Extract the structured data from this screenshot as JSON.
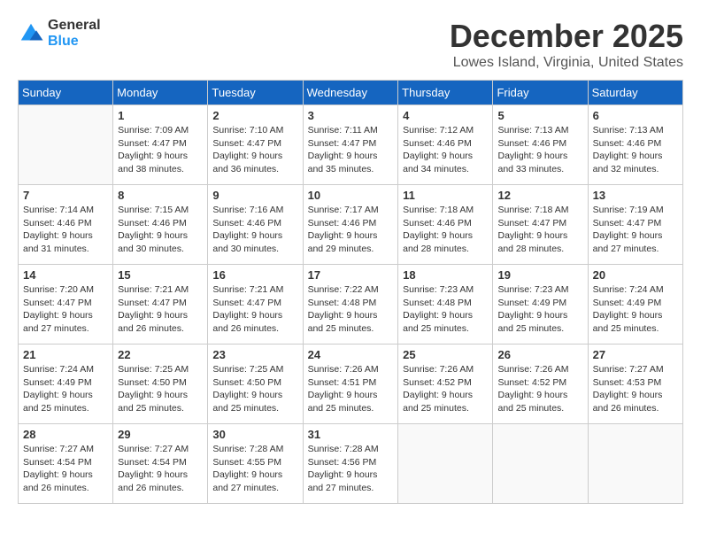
{
  "logo": {
    "general": "General",
    "blue": "Blue"
  },
  "title": "December 2025",
  "location": "Lowes Island, Virginia, United States",
  "days_of_week": [
    "Sunday",
    "Monday",
    "Tuesday",
    "Wednesday",
    "Thursday",
    "Friday",
    "Saturday"
  ],
  "weeks": [
    [
      {
        "day": "",
        "sunrise": "",
        "sunset": "",
        "daylight": ""
      },
      {
        "day": "1",
        "sunrise": "Sunrise: 7:09 AM",
        "sunset": "Sunset: 4:47 PM",
        "daylight": "Daylight: 9 hours and 38 minutes."
      },
      {
        "day": "2",
        "sunrise": "Sunrise: 7:10 AM",
        "sunset": "Sunset: 4:47 PM",
        "daylight": "Daylight: 9 hours and 36 minutes."
      },
      {
        "day": "3",
        "sunrise": "Sunrise: 7:11 AM",
        "sunset": "Sunset: 4:47 PM",
        "daylight": "Daylight: 9 hours and 35 minutes."
      },
      {
        "day": "4",
        "sunrise": "Sunrise: 7:12 AM",
        "sunset": "Sunset: 4:46 PM",
        "daylight": "Daylight: 9 hours and 34 minutes."
      },
      {
        "day": "5",
        "sunrise": "Sunrise: 7:13 AM",
        "sunset": "Sunset: 4:46 PM",
        "daylight": "Daylight: 9 hours and 33 minutes."
      },
      {
        "day": "6",
        "sunrise": "Sunrise: 7:13 AM",
        "sunset": "Sunset: 4:46 PM",
        "daylight": "Daylight: 9 hours and 32 minutes."
      }
    ],
    [
      {
        "day": "7",
        "sunrise": "Sunrise: 7:14 AM",
        "sunset": "Sunset: 4:46 PM",
        "daylight": "Daylight: 9 hours and 31 minutes."
      },
      {
        "day": "8",
        "sunrise": "Sunrise: 7:15 AM",
        "sunset": "Sunset: 4:46 PM",
        "daylight": "Daylight: 9 hours and 30 minutes."
      },
      {
        "day": "9",
        "sunrise": "Sunrise: 7:16 AM",
        "sunset": "Sunset: 4:46 PM",
        "daylight": "Daylight: 9 hours and 30 minutes."
      },
      {
        "day": "10",
        "sunrise": "Sunrise: 7:17 AM",
        "sunset": "Sunset: 4:46 PM",
        "daylight": "Daylight: 9 hours and 29 minutes."
      },
      {
        "day": "11",
        "sunrise": "Sunrise: 7:18 AM",
        "sunset": "Sunset: 4:46 PM",
        "daylight": "Daylight: 9 hours and 28 minutes."
      },
      {
        "day": "12",
        "sunrise": "Sunrise: 7:18 AM",
        "sunset": "Sunset: 4:47 PM",
        "daylight": "Daylight: 9 hours and 28 minutes."
      },
      {
        "day": "13",
        "sunrise": "Sunrise: 7:19 AM",
        "sunset": "Sunset: 4:47 PM",
        "daylight": "Daylight: 9 hours and 27 minutes."
      }
    ],
    [
      {
        "day": "14",
        "sunrise": "Sunrise: 7:20 AM",
        "sunset": "Sunset: 4:47 PM",
        "daylight": "Daylight: 9 hours and 27 minutes."
      },
      {
        "day": "15",
        "sunrise": "Sunrise: 7:21 AM",
        "sunset": "Sunset: 4:47 PM",
        "daylight": "Daylight: 9 hours and 26 minutes."
      },
      {
        "day": "16",
        "sunrise": "Sunrise: 7:21 AM",
        "sunset": "Sunset: 4:47 PM",
        "daylight": "Daylight: 9 hours and 26 minutes."
      },
      {
        "day": "17",
        "sunrise": "Sunrise: 7:22 AM",
        "sunset": "Sunset: 4:48 PM",
        "daylight": "Daylight: 9 hours and 25 minutes."
      },
      {
        "day": "18",
        "sunrise": "Sunrise: 7:23 AM",
        "sunset": "Sunset: 4:48 PM",
        "daylight": "Daylight: 9 hours and 25 minutes."
      },
      {
        "day": "19",
        "sunrise": "Sunrise: 7:23 AM",
        "sunset": "Sunset: 4:49 PM",
        "daylight": "Daylight: 9 hours and 25 minutes."
      },
      {
        "day": "20",
        "sunrise": "Sunrise: 7:24 AM",
        "sunset": "Sunset: 4:49 PM",
        "daylight": "Daylight: 9 hours and 25 minutes."
      }
    ],
    [
      {
        "day": "21",
        "sunrise": "Sunrise: 7:24 AM",
        "sunset": "Sunset: 4:49 PM",
        "daylight": "Daylight: 9 hours and 25 minutes."
      },
      {
        "day": "22",
        "sunrise": "Sunrise: 7:25 AM",
        "sunset": "Sunset: 4:50 PM",
        "daylight": "Daylight: 9 hours and 25 minutes."
      },
      {
        "day": "23",
        "sunrise": "Sunrise: 7:25 AM",
        "sunset": "Sunset: 4:50 PM",
        "daylight": "Daylight: 9 hours and 25 minutes."
      },
      {
        "day": "24",
        "sunrise": "Sunrise: 7:26 AM",
        "sunset": "Sunset: 4:51 PM",
        "daylight": "Daylight: 9 hours and 25 minutes."
      },
      {
        "day": "25",
        "sunrise": "Sunrise: 7:26 AM",
        "sunset": "Sunset: 4:52 PM",
        "daylight": "Daylight: 9 hours and 25 minutes."
      },
      {
        "day": "26",
        "sunrise": "Sunrise: 7:26 AM",
        "sunset": "Sunset: 4:52 PM",
        "daylight": "Daylight: 9 hours and 25 minutes."
      },
      {
        "day": "27",
        "sunrise": "Sunrise: 7:27 AM",
        "sunset": "Sunset: 4:53 PM",
        "daylight": "Daylight: 9 hours and 26 minutes."
      }
    ],
    [
      {
        "day": "28",
        "sunrise": "Sunrise: 7:27 AM",
        "sunset": "Sunset: 4:54 PM",
        "daylight": "Daylight: 9 hours and 26 minutes."
      },
      {
        "day": "29",
        "sunrise": "Sunrise: 7:27 AM",
        "sunset": "Sunset: 4:54 PM",
        "daylight": "Daylight: 9 hours and 26 minutes."
      },
      {
        "day": "30",
        "sunrise": "Sunrise: 7:28 AM",
        "sunset": "Sunset: 4:55 PM",
        "daylight": "Daylight: 9 hours and 27 minutes."
      },
      {
        "day": "31",
        "sunrise": "Sunrise: 7:28 AM",
        "sunset": "Sunset: 4:56 PM",
        "daylight": "Daylight: 9 hours and 27 minutes."
      },
      {
        "day": "",
        "sunrise": "",
        "sunset": "",
        "daylight": ""
      },
      {
        "day": "",
        "sunrise": "",
        "sunset": "",
        "daylight": ""
      },
      {
        "day": "",
        "sunrise": "",
        "sunset": "",
        "daylight": ""
      }
    ]
  ]
}
